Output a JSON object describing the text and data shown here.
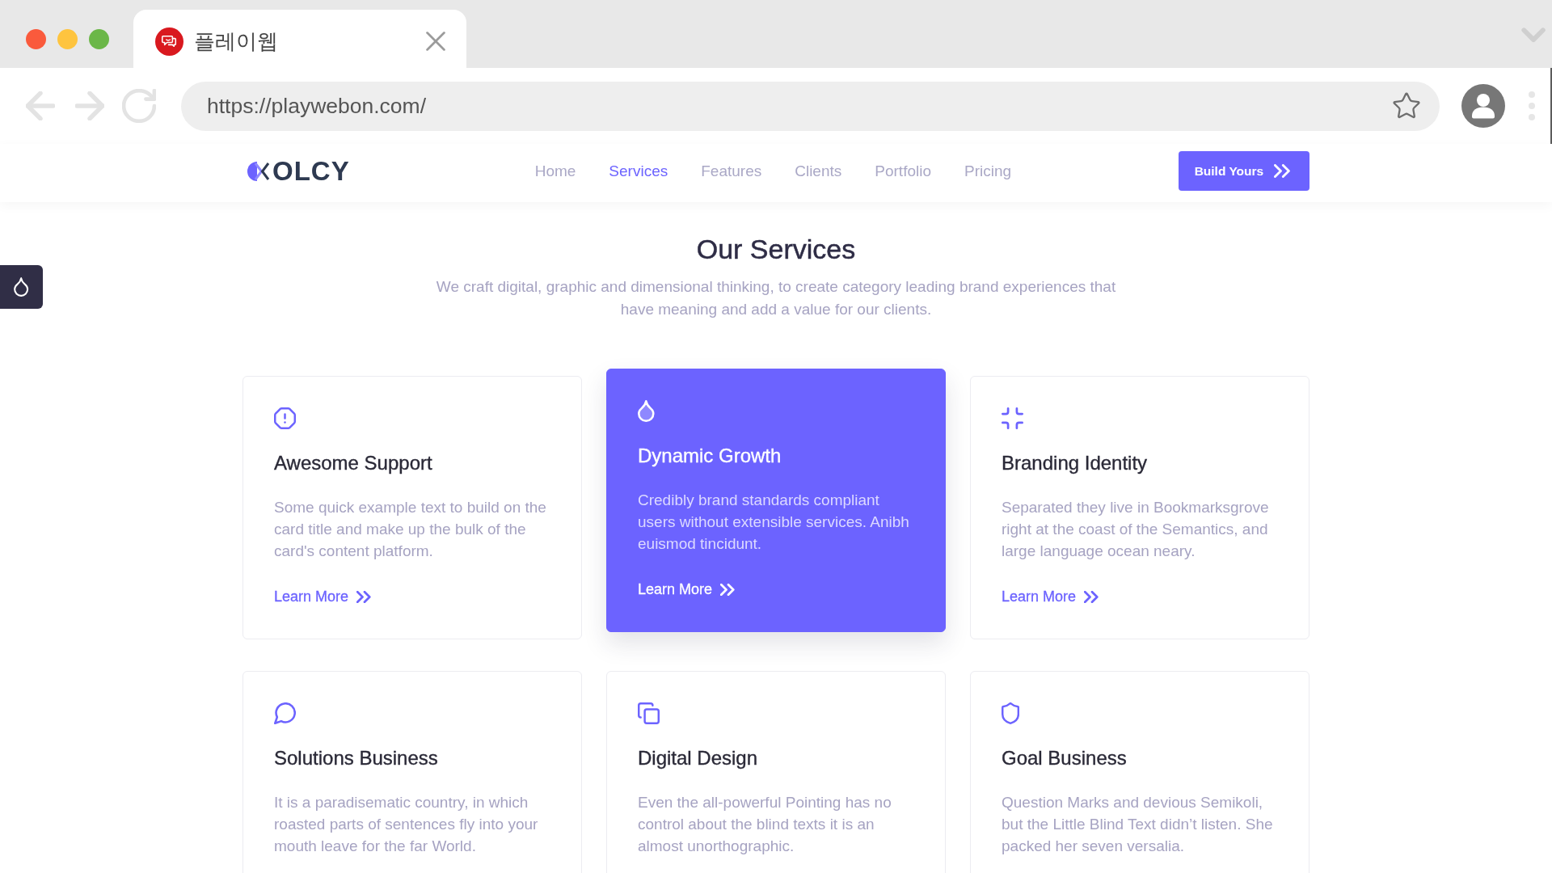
{
  "browser": {
    "tab": {
      "title": "플레이웹"
    },
    "address_bar": {
      "url": "https://playwebon.com/"
    }
  },
  "header": {
    "logo": "OLCY",
    "nav": [
      {
        "label": "Home",
        "selected": false
      },
      {
        "label": "Services",
        "selected": true
      },
      {
        "label": "Features",
        "selected": false
      },
      {
        "label": "Clients",
        "selected": false
      },
      {
        "label": "Portfolio",
        "selected": false
      },
      {
        "label": "Pricing",
        "selected": false
      }
    ],
    "button": "Build Yours"
  },
  "section": {
    "title": "Our Services",
    "subtitle": "We craft digital, graphic and dimensional thinking, to create category leading brand experiences that have meaning and add a value for our clients."
  },
  "cards": [
    {
      "title": "Awesome Support",
      "text": "Some quick example text to build on the card title and make up the bulk of the card's content platform.",
      "link": "Learn More",
      "selected": false
    },
    {
      "title": "Dynamic Growth",
      "text": "Credibly brand standards compliant users without extensible services. Anibh euismod tincidunt.",
      "link": "Learn More",
      "selected": true
    },
    {
      "title": "Branding Identity",
      "text": "Separated they live in Bookmarksgrove right at the coast of the Semantics, and large language ocean neary.",
      "link": "Learn More",
      "selected": false
    },
    {
      "title": "Solutions Business",
      "text": "It is a paradisematic country, in which roasted parts of sentences fly into your mouth leave for the far World.",
      "selected": false
    },
    {
      "title": "Digital Design",
      "text": "Even the all-powerful Pointing has no control about the blind texts it is an almost unorthographic.",
      "selected": false
    },
    {
      "title": "Goal Business",
      "text": "Question Marks and devious Semikoli, but the Little Blind Text didn’t listen. She packed her seven versalia.",
      "selected": false
    }
  ]
}
